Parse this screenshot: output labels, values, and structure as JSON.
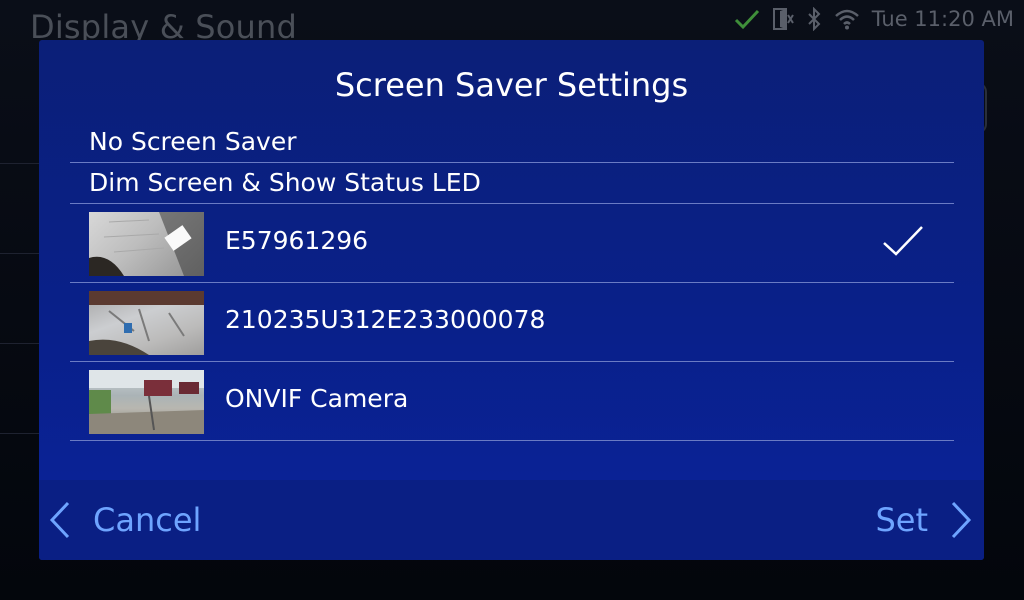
{
  "background": {
    "title": "Display & Sound"
  },
  "status_bar": {
    "time": "Tue 11:20 AM",
    "icons": [
      "check-icon",
      "door-icon",
      "bluetooth-icon",
      "wifi-icon"
    ]
  },
  "dialog": {
    "title": "Screen Saver Settings",
    "options": [
      {
        "label": "No Screen Saver"
      },
      {
        "label": "Dim Screen & Show Status LED"
      }
    ],
    "cameras": [
      {
        "label": "E57961296",
        "selected": true
      },
      {
        "label": "210235U312E233000078",
        "selected": false
      },
      {
        "label": "ONVIF Camera",
        "selected": false
      }
    ],
    "cancel_label": "Cancel",
    "set_label": "Set"
  },
  "colors": {
    "dialog_bg": "#0b2088",
    "accent_text": "#6ea4ff",
    "divider": "#6a7bc4"
  }
}
